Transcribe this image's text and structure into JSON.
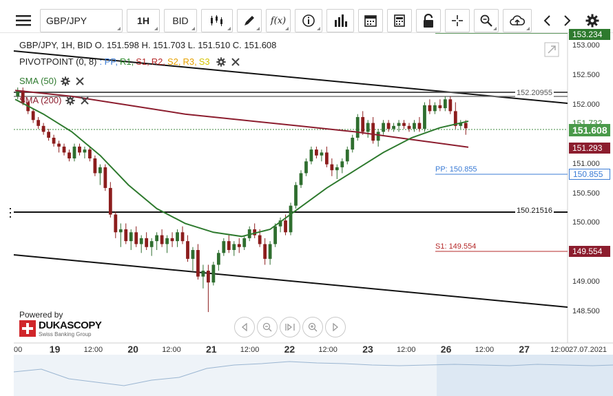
{
  "toolbar": {
    "menu_icon": "hamburger-menu-icon",
    "symbol": "GBP/JPY",
    "timeframe": "1H",
    "price_type": "BID",
    "icons": [
      "candlestick-icon",
      "pencil-icon",
      "function-icon",
      "info-icon",
      "bar-chart-icon",
      "calendar-icon",
      "document-icon",
      "lock-icon",
      "crosshair-icon",
      "zoom-icon",
      "cloud-upload-icon",
      "chevron-left-icon",
      "chevron-right-icon",
      "gear-icon"
    ],
    "fx_label": "f(x)"
  },
  "header": {
    "line": "GBP/JPY, 1H, BID    O. 151.598 H. 151.703 L. 151.510 C. 151.608",
    "pivot_label": "PIVOTPOINT (0, 8)",
    "pivot_levels": [
      {
        "label": ": PP,",
        "color": "#3a7bd5"
      },
      {
        "label": "R1,",
        "color": "#2e8b2e"
      },
      {
        "label": "S1,",
        "color": "#b52828"
      },
      {
        "label": "R2,",
        "color": "#b52828"
      },
      {
        "label": "S2,",
        "color": "#e6a100"
      },
      {
        "label": "R3,",
        "color": "#e6a100"
      },
      {
        "label": "S3",
        "color": "#d4c400"
      }
    ],
    "sma50_label": "SMA (50)",
    "sma200_label": "SMA (200)"
  },
  "levels": {
    "top_level_label": "152.20955",
    "mid_level_label": "150.21516",
    "pp_label": "PP: 150.855",
    "s1_label": "S1: 149.554"
  },
  "price_tags": {
    "top_partial": "153.234",
    "sma50": "151.732",
    "last": "151.608",
    "sma200": "151.293",
    "pp": "150.855",
    "s1": "149.554"
  },
  "y_axis": [
    "153.000",
    "152.500",
    "152.000",
    "151.500",
    "151.000",
    "150.500",
    "150.000",
    "149.500",
    "149.000",
    "148.500"
  ],
  "x_axis": [
    {
      "label": "00",
      "big": false
    },
    {
      "label": "19",
      "big": true
    },
    {
      "label": "12:00",
      "big": false
    },
    {
      "label": "20",
      "big": true
    },
    {
      "label": "12:00",
      "big": false
    },
    {
      "label": "21",
      "big": true
    },
    {
      "label": "12:00",
      "big": false
    },
    {
      "label": "22",
      "big": true
    },
    {
      "label": "12:00",
      "big": false
    },
    {
      "label": "23",
      "big": true
    },
    {
      "label": "12:00",
      "big": false
    },
    {
      "label": "26",
      "big": true
    },
    {
      "label": "12:00",
      "big": false
    },
    {
      "label": "27",
      "big": true
    },
    {
      "label": "12:00",
      "big": false
    },
    {
      "label": "27.07.2021",
      "big": false
    }
  ],
  "branding": {
    "powered_by": "Powered by",
    "name": "DUKASCOPY",
    "tagline": "Swiss Banking Group"
  },
  "colors": {
    "up": "#2f6e2f",
    "down": "#8c1d1d",
    "sma50": "#2e7a2e",
    "sma200": "#8c1d2e",
    "pp": "#3a7bd5",
    "s1": "#b52828",
    "axis_green": "#2e7a2e"
  },
  "candles": [
    [
      152.15,
      152.3,
      152.1,
      152.25
    ],
    [
      152.25,
      152.3,
      152.0,
      152.05
    ],
    [
      152.05,
      152.1,
      151.85,
      151.9
    ],
    [
      151.9,
      151.95,
      151.7,
      151.75
    ],
    [
      151.75,
      151.8,
      151.6,
      151.65
    ],
    [
      151.65,
      151.7,
      151.5,
      151.55
    ],
    [
      151.55,
      151.6,
      151.4,
      151.45
    ],
    [
      151.45,
      151.5,
      151.3,
      151.35
    ],
    [
      151.35,
      151.4,
      151.2,
      151.3
    ],
    [
      151.3,
      151.35,
      151.15,
      151.2
    ],
    [
      151.2,
      151.25,
      151.05,
      151.1
    ],
    [
      151.1,
      151.35,
      151.05,
      151.3
    ],
    [
      151.3,
      151.35,
      151.15,
      151.2
    ],
    [
      151.2,
      151.3,
      151.1,
      151.25
    ],
    [
      151.25,
      151.3,
      151.05,
      151.1
    ],
    [
      151.1,
      151.15,
      150.8,
      150.85
    ],
    [
      150.85,
      151.0,
      150.65,
      150.95
    ],
    [
      150.95,
      151.0,
      150.55,
      150.6
    ],
    [
      150.6,
      150.7,
      150.1,
      150.15
    ],
    [
      150.15,
      150.2,
      149.75,
      149.85
    ],
    [
      149.85,
      150.0,
      149.6,
      149.9
    ],
    [
      149.9,
      150.0,
      149.65,
      149.7
    ],
    [
      149.7,
      149.9,
      149.55,
      149.85
    ],
    [
      149.85,
      149.95,
      149.6,
      149.65
    ],
    [
      149.65,
      149.8,
      149.5,
      149.75
    ],
    [
      149.75,
      149.85,
      149.55,
      149.6
    ],
    [
      149.6,
      149.75,
      149.45,
      149.7
    ],
    [
      149.7,
      149.85,
      149.55,
      149.8
    ],
    [
      149.8,
      149.9,
      149.6,
      149.65
    ],
    [
      149.65,
      149.8,
      149.5,
      149.75
    ],
    [
      149.75,
      149.85,
      149.6,
      149.7
    ],
    [
      149.7,
      149.9,
      149.6,
      149.85
    ],
    [
      149.85,
      149.95,
      149.65,
      149.7
    ],
    [
      149.7,
      149.8,
      149.35,
      149.4
    ],
    [
      149.4,
      149.6,
      149.2,
      149.55
    ],
    [
      149.55,
      149.65,
      149.05,
      149.1
    ],
    [
      149.1,
      149.3,
      148.9,
      149.2
    ],
    [
      149.2,
      149.3,
      148.5,
      149.0
    ],
    [
      149.0,
      149.35,
      148.95,
      149.3
    ],
    [
      149.3,
      149.55,
      149.2,
      149.5
    ],
    [
      149.5,
      149.75,
      149.45,
      149.7
    ],
    [
      149.7,
      149.8,
      149.5,
      149.55
    ],
    [
      149.55,
      149.7,
      149.45,
      149.65
    ],
    [
      149.65,
      149.75,
      149.5,
      149.6
    ],
    [
      149.6,
      149.8,
      149.55,
      149.75
    ],
    [
      149.75,
      149.95,
      149.7,
      149.9
    ],
    [
      149.9,
      150.0,
      149.75,
      149.8
    ],
    [
      149.8,
      149.9,
      149.6,
      149.65
    ],
    [
      149.65,
      149.75,
      149.3,
      149.4
    ],
    [
      149.4,
      149.7,
      149.3,
      149.65
    ],
    [
      149.65,
      150.0,
      149.6,
      149.95
    ],
    [
      149.95,
      150.1,
      149.85,
      150.05
    ],
    [
      150.05,
      150.15,
      149.8,
      149.85
    ],
    [
      149.85,
      150.35,
      149.8,
      150.3
    ],
    [
      150.3,
      150.7,
      150.25,
      150.65
    ],
    [
      150.65,
      150.9,
      150.6,
      150.85
    ],
    [
      150.85,
      151.1,
      150.8,
      151.05
    ],
    [
      151.05,
      151.3,
      151.0,
      151.25
    ],
    [
      151.25,
      151.3,
      151.1,
      151.15
    ],
    [
      151.15,
      151.25,
      151.05,
      151.2
    ],
    [
      151.2,
      151.3,
      150.95,
      151.0
    ],
    [
      151.0,
      151.1,
      150.8,
      150.9
    ],
    [
      150.9,
      151.0,
      150.75,
      150.95
    ],
    [
      150.95,
      151.1,
      150.85,
      151.05
    ],
    [
      151.05,
      151.3,
      151.0,
      151.25
    ],
    [
      151.25,
      151.5,
      151.2,
      151.45
    ],
    [
      151.45,
      151.85,
      151.4,
      151.8
    ],
    [
      151.8,
      151.9,
      151.5,
      151.55
    ],
    [
      151.55,
      151.75,
      151.45,
      151.7
    ],
    [
      151.7,
      151.8,
      151.35,
      151.4
    ],
    [
      151.4,
      151.6,
      151.3,
      151.55
    ],
    [
      151.55,
      151.75,
      151.5,
      151.7
    ],
    [
      151.7,
      151.75,
      151.55,
      151.6
    ],
    [
      151.6,
      151.7,
      151.55,
      151.65
    ],
    [
      151.65,
      151.75,
      151.55,
      151.7
    ],
    [
      151.7,
      151.75,
      151.6,
      151.65
    ],
    [
      151.65,
      151.7,
      151.55,
      151.6
    ],
    [
      151.6,
      151.75,
      151.55,
      151.7
    ],
    [
      151.7,
      151.8,
      151.55,
      151.6
    ],
    [
      151.6,
      152.05,
      151.55,
      152.0
    ],
    [
      152.0,
      152.1,
      151.85,
      151.9
    ],
    [
      151.9,
      152.05,
      151.85,
      152.0
    ],
    [
      152.0,
      152.1,
      151.9,
      151.95
    ],
    [
      151.95,
      152.15,
      151.9,
      152.1
    ],
    [
      152.1,
      152.15,
      151.85,
      151.9
    ],
    [
      151.9,
      152.05,
      151.6,
      151.65
    ],
    [
      151.65,
      151.75,
      151.6,
      151.7
    ],
    [
      151.7,
      151.75,
      151.5,
      151.61
    ]
  ],
  "sma50": [
    [
      0,
      152.1
    ],
    [
      0.05,
      151.85
    ],
    [
      0.1,
      151.55
    ],
    [
      0.15,
      151.15
    ],
    [
      0.2,
      150.65
    ],
    [
      0.25,
      150.25
    ],
    [
      0.3,
      150.0
    ],
    [
      0.35,
      149.85
    ],
    [
      0.4,
      149.78
    ],
    [
      0.45,
      149.9
    ],
    [
      0.5,
      150.25
    ],
    [
      0.55,
      150.6
    ],
    [
      0.6,
      150.9
    ],
    [
      0.65,
      151.2
    ],
    [
      0.7,
      151.45
    ],
    [
      0.75,
      151.62
    ],
    [
      0.8,
      151.73
    ]
  ],
  "sma200": [
    [
      0,
      152.25
    ],
    [
      0.1,
      152.15
    ],
    [
      0.2,
      152.0
    ],
    [
      0.3,
      151.85
    ],
    [
      0.4,
      151.75
    ],
    [
      0.5,
      151.65
    ],
    [
      0.6,
      151.55
    ],
    [
      0.7,
      151.42
    ],
    [
      0.8,
      151.29
    ]
  ]
}
